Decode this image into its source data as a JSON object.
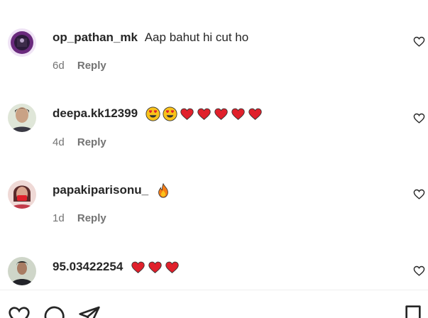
{
  "comments": [
    {
      "username": "op_pathan_mk",
      "text": "Aap bahut hi cut ho",
      "time": "6d",
      "reply_label": "Reply",
      "avatar_icon": "profile-avatar-icon",
      "like_icon": "heart-outline-icon"
    },
    {
      "username": "deepa.kk12399",
      "emojis": [
        "heart-eyes",
        "heart-eyes",
        "red-heart",
        "red-heart",
        "red-heart",
        "red-heart",
        "red-heart"
      ],
      "time": "4d",
      "reply_label": "Reply",
      "avatar_icon": "profile-avatar-icon",
      "like_icon": "heart-outline-icon"
    },
    {
      "username": "papakiparisonu_",
      "emojis": [
        "fire"
      ],
      "time": "1d",
      "reply_label": "Reply",
      "avatar_icon": "profile-avatar-icon",
      "like_icon": "heart-outline-icon"
    },
    {
      "username": "95.03422254",
      "emojis": [
        "red-heart",
        "red-heart",
        "red-heart"
      ],
      "avatar_icon": "profile-avatar-icon",
      "like_icon": "heart-outline-icon"
    }
  ],
  "footer": {
    "icons": [
      "heart-outline-icon",
      "comment-icon",
      "share-icon",
      "bookmark-icon"
    ]
  },
  "colors": {
    "text": "#262626",
    "secondary": "#737373",
    "heart_red": "#e0202b",
    "emoji_yellow": "#f9c21b"
  }
}
